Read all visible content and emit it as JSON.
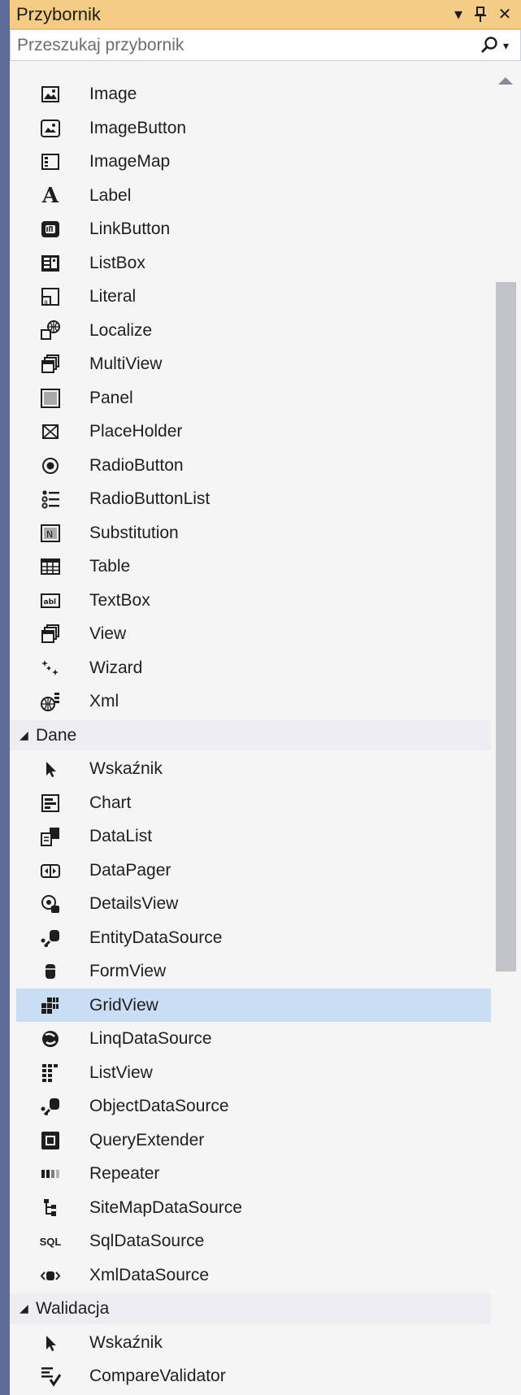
{
  "window": {
    "title": "Przybornik",
    "dropdown_glyph": "▾",
    "pin_glyph": "ᛣ",
    "close_glyph": "✕"
  },
  "search": {
    "placeholder": "Przeszukaj przybornik",
    "dropdown_glyph": "▾"
  },
  "rows": [
    {
      "type": "item",
      "label": "Image",
      "icon": "image-icon"
    },
    {
      "type": "item",
      "label": "ImageButton",
      "icon": "image-button-icon"
    },
    {
      "type": "item",
      "label": "ImageMap",
      "icon": "image-map-icon"
    },
    {
      "type": "item",
      "label": "Label",
      "icon": "label-icon"
    },
    {
      "type": "item",
      "label": "LinkButton",
      "icon": "link-button-icon"
    },
    {
      "type": "item",
      "label": "ListBox",
      "icon": "list-box-icon"
    },
    {
      "type": "item",
      "label": "Literal",
      "icon": "literal-icon"
    },
    {
      "type": "item",
      "label": "Localize",
      "icon": "localize-icon"
    },
    {
      "type": "item",
      "label": "MultiView",
      "icon": "multi-view-icon"
    },
    {
      "type": "item",
      "label": "Panel",
      "icon": "panel-icon"
    },
    {
      "type": "item",
      "label": "PlaceHolder",
      "icon": "placeholder-icon"
    },
    {
      "type": "item",
      "label": "RadioButton",
      "icon": "radio-button-icon"
    },
    {
      "type": "item",
      "label": "RadioButtonList",
      "icon": "radio-button-list-icon"
    },
    {
      "type": "item",
      "label": "Substitution",
      "icon": "substitution-icon"
    },
    {
      "type": "item",
      "label": "Table",
      "icon": "table-icon"
    },
    {
      "type": "item",
      "label": "TextBox",
      "icon": "text-box-icon"
    },
    {
      "type": "item",
      "label": "View",
      "icon": "view-icon"
    },
    {
      "type": "item",
      "label": "Wizard",
      "icon": "wizard-icon"
    },
    {
      "type": "item",
      "label": "Xml",
      "icon": "xml-icon"
    },
    {
      "type": "category",
      "label": "Dane",
      "glyph": "◢"
    },
    {
      "type": "item",
      "label": "Wskaźnik",
      "icon": "pointer-icon"
    },
    {
      "type": "item",
      "label": "Chart",
      "icon": "chart-icon"
    },
    {
      "type": "item",
      "label": "DataList",
      "icon": "data-list-icon"
    },
    {
      "type": "item",
      "label": "DataPager",
      "icon": "data-pager-icon"
    },
    {
      "type": "item",
      "label": "DetailsView",
      "icon": "details-view-icon"
    },
    {
      "type": "item",
      "label": "EntityDataSource",
      "icon": "entity-data-source-icon"
    },
    {
      "type": "item",
      "label": "FormView",
      "icon": "form-view-icon"
    },
    {
      "type": "item",
      "label": "GridView",
      "icon": "grid-view-icon",
      "selected": true
    },
    {
      "type": "item",
      "label": "LinqDataSource",
      "icon": "linq-data-source-icon"
    },
    {
      "type": "item",
      "label": "ListView",
      "icon": "list-view-icon"
    },
    {
      "type": "item",
      "label": "ObjectDataSource",
      "icon": "object-data-source-icon"
    },
    {
      "type": "item",
      "label": "QueryExtender",
      "icon": "query-extender-icon"
    },
    {
      "type": "item",
      "label": "Repeater",
      "icon": "repeater-icon"
    },
    {
      "type": "item",
      "label": "SiteMapDataSource",
      "icon": "site-map-data-source-icon"
    },
    {
      "type": "item",
      "label": "SqlDataSource",
      "icon": "sql-data-source-icon",
      "icon_text": "SQL"
    },
    {
      "type": "item",
      "label": "XmlDataSource",
      "icon": "xml-data-source-icon"
    },
    {
      "type": "category",
      "label": "Walidacja",
      "glyph": "◢"
    },
    {
      "type": "item",
      "label": "Wskaźnik",
      "icon": "pointer-icon"
    },
    {
      "type": "item",
      "label": "CompareValidator",
      "icon": "compare-validator-icon"
    }
  ],
  "colors": {
    "titlebar": "#f5cc84",
    "selected_row": "#c9def5",
    "category_row": "#eeeef2",
    "panel_bg": "#f5f5f5",
    "frame": "#5d6b99"
  }
}
